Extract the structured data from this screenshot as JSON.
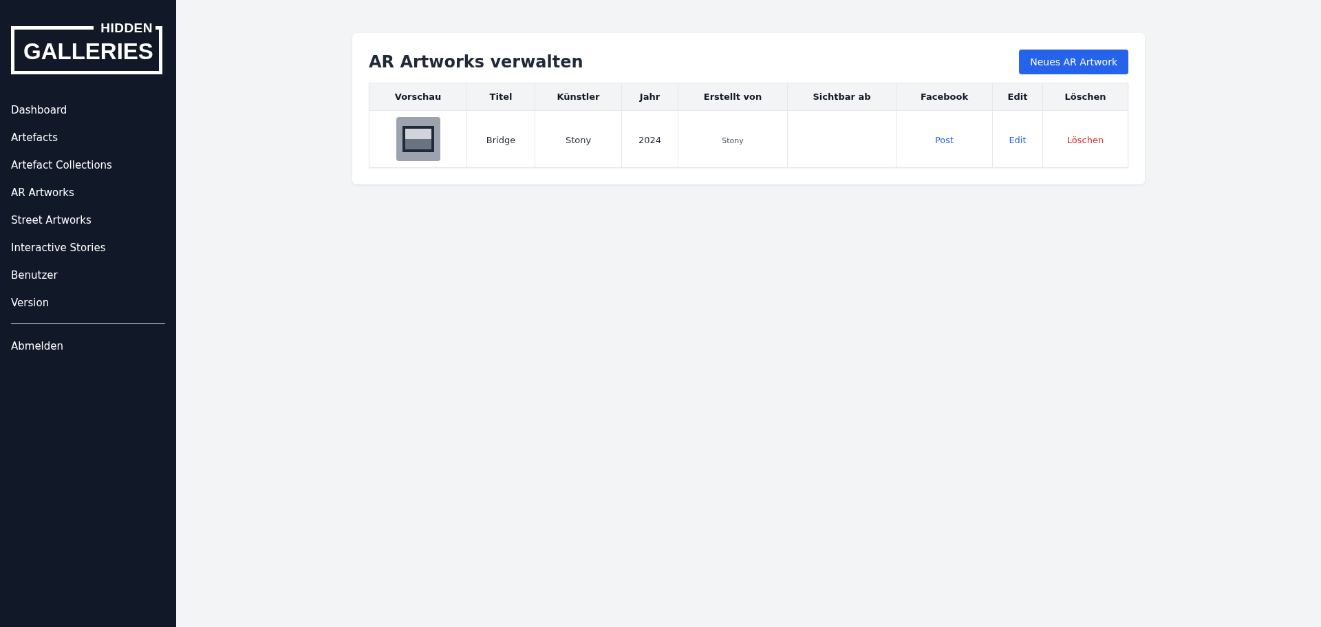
{
  "logo": {
    "top": "HIDDEN",
    "main": "GALLERIES"
  },
  "nav": [
    {
      "label": "Dashboard"
    },
    {
      "label": "Artefacts"
    },
    {
      "label": "Artefact Collections"
    },
    {
      "label": "AR Artworks"
    },
    {
      "label": "Street Artworks"
    },
    {
      "label": "Interactive Stories"
    },
    {
      "label": "Benutzer"
    },
    {
      "label": "Version"
    }
  ],
  "logout": "Abmelden",
  "page": {
    "title": "AR Artworks verwalten",
    "new_button": "Neues AR Artwork"
  },
  "table": {
    "columns": [
      "Vorschau",
      "Titel",
      "Künstler",
      "Jahr",
      "Erstellt von",
      "Sichtbar ab",
      "Facebook",
      "Edit",
      "Löschen"
    ],
    "rows": [
      {
        "title": "Bridge",
        "artist": "Stony",
        "year": "2024",
        "created_by": "Stony",
        "facebook": "Post",
        "edit": "Edit",
        "delete": "Löschen"
      }
    ]
  }
}
